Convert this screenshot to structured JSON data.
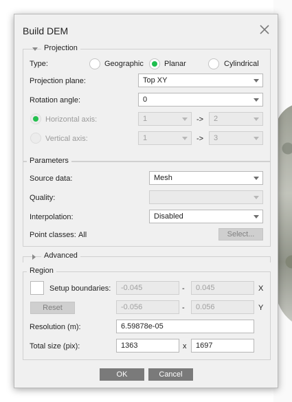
{
  "dialog": {
    "title": "Build DEM",
    "ok_label": "OK",
    "cancel_label": "Cancel"
  },
  "projection": {
    "legend": "Projection",
    "type_label": "Type:",
    "types": [
      "Geographic",
      "Planar",
      "Cylindrical"
    ],
    "selected_type": "Planar",
    "plane_label": "Projection plane:",
    "plane_value": "Top XY",
    "rotation_label": "Rotation angle:",
    "rotation_value": "0",
    "horizontal_label": "Horizontal axis:",
    "horizontal_from": "1",
    "horizontal_to": "2",
    "vertical_label": "Vertical axis:",
    "vertical_from": "1",
    "vertical_to": "3",
    "arrow_text": "->"
  },
  "parameters": {
    "legend": "Parameters",
    "source_label": "Source data:",
    "source_value": "Mesh",
    "quality_label": "Quality:",
    "quality_value": "",
    "interpolation_label": "Interpolation:",
    "interpolation_value": "Disabled",
    "point_classes_label": "Point classes:",
    "point_classes_value": "All",
    "select_label": "Select..."
  },
  "advanced": {
    "legend": "Advanced"
  },
  "region": {
    "legend": "Region",
    "setup_label": "Setup boundaries:",
    "reset_label": "Reset",
    "x_min": "-0.045",
    "x_max": "0.045",
    "y_min": "-0.056",
    "y_max": "0.056",
    "dash": "-",
    "x_axis": "X",
    "y_axis": "Y",
    "resolution_label": "Resolution (m):",
    "resolution_value": "6.59878e-05",
    "total_size_label": "Total size (pix):",
    "width_value": "1363",
    "height_value": "1697",
    "times": "x"
  }
}
